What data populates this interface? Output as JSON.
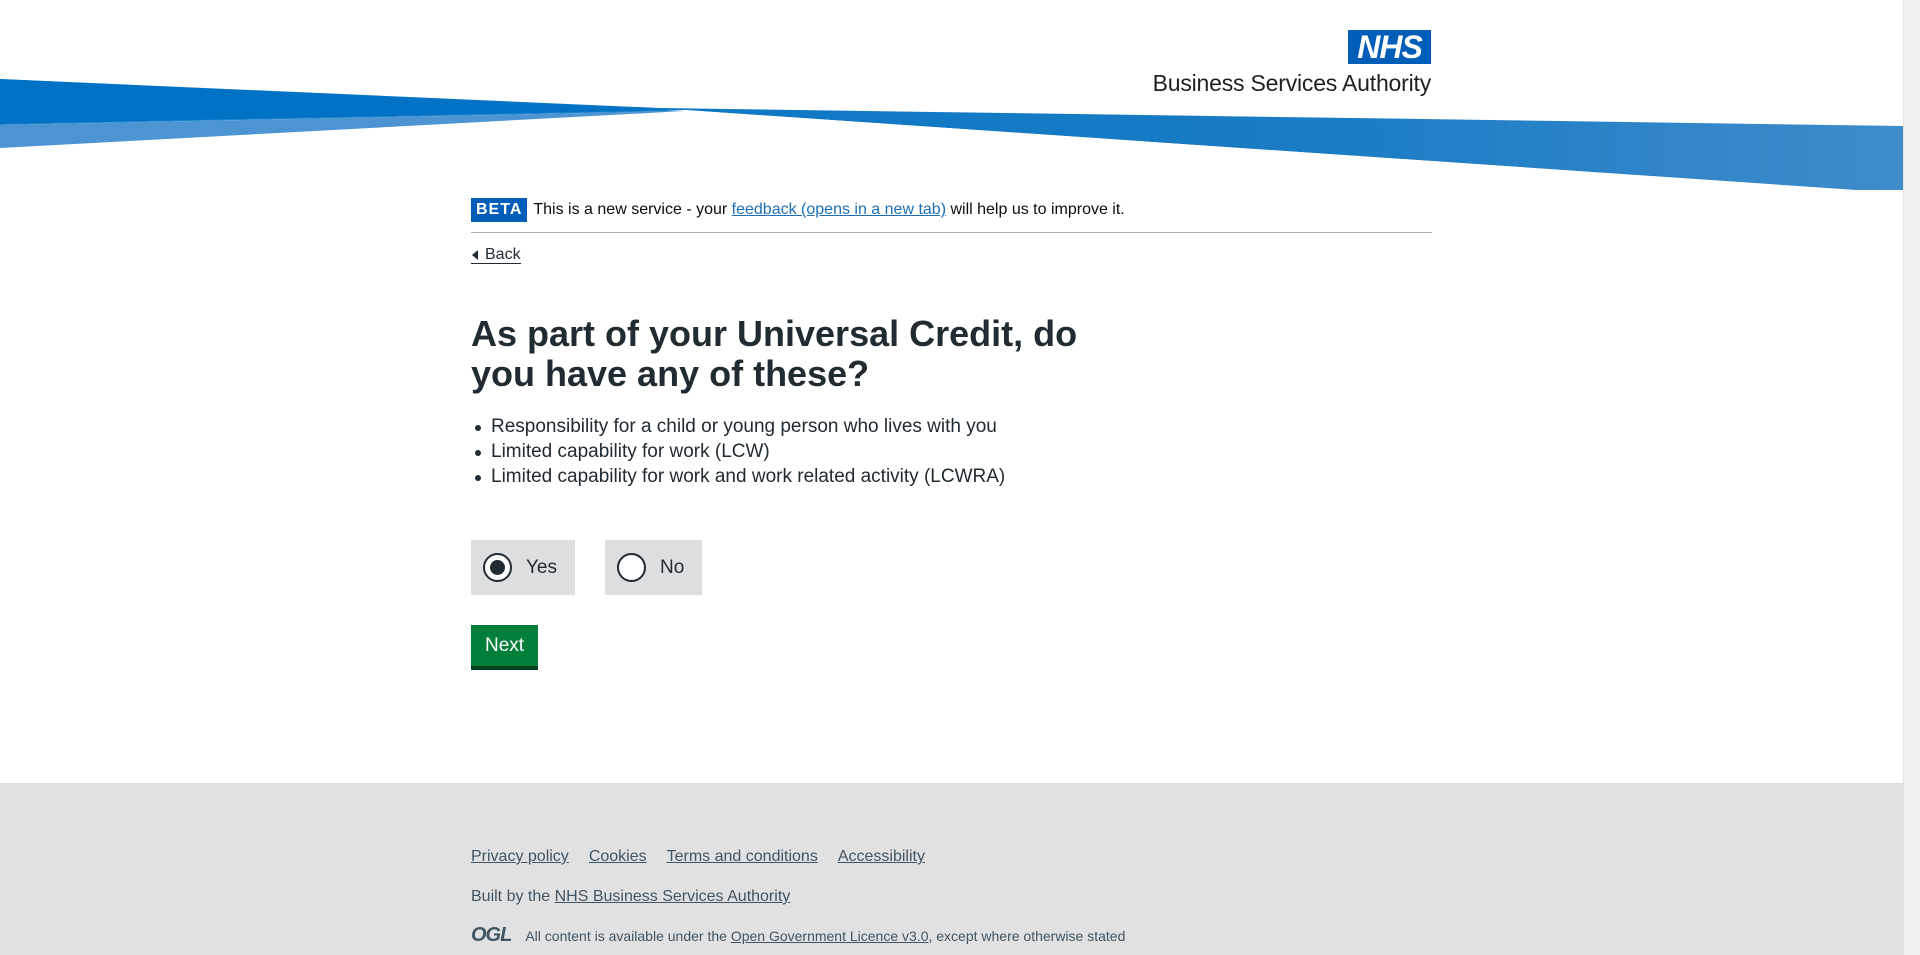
{
  "header": {
    "logo_nhs": "NHS",
    "logo_org": "Business Services Authority"
  },
  "beta": {
    "tag": "BETA",
    "text_before": "This is a new service - your ",
    "link": "feedback (opens in a new tab)",
    "text_after": " will help us to improve it."
  },
  "nav": {
    "back": "Back"
  },
  "question": {
    "title": "As part of your Universal Credit, do you have any of these?",
    "items": [
      "Responsibility for a child or young person who lives with you",
      "Limited capability for work (LCW)",
      "Limited capability for work and work related activity (LCWRA)"
    ],
    "options": [
      {
        "label": "Yes",
        "selected": true
      },
      {
        "label": "No",
        "selected": false
      }
    ],
    "submit": "Next"
  },
  "footer": {
    "links": [
      "Privacy policy",
      "Cookies",
      "Terms and conditions",
      "Accessibility"
    ],
    "built_prefix": "Built by the ",
    "built_link": "NHS Business Services Authority",
    "ogl": "OGL",
    "licence_prefix": "All content is available under the ",
    "licence_link": "Open Government Licence v3.0",
    "licence_suffix": ", except where otherwise stated"
  },
  "colors": {
    "nhs_blue": "#005eb8",
    "button_green": "#007f3b",
    "footer_bg": "#e0e1e2"
  }
}
